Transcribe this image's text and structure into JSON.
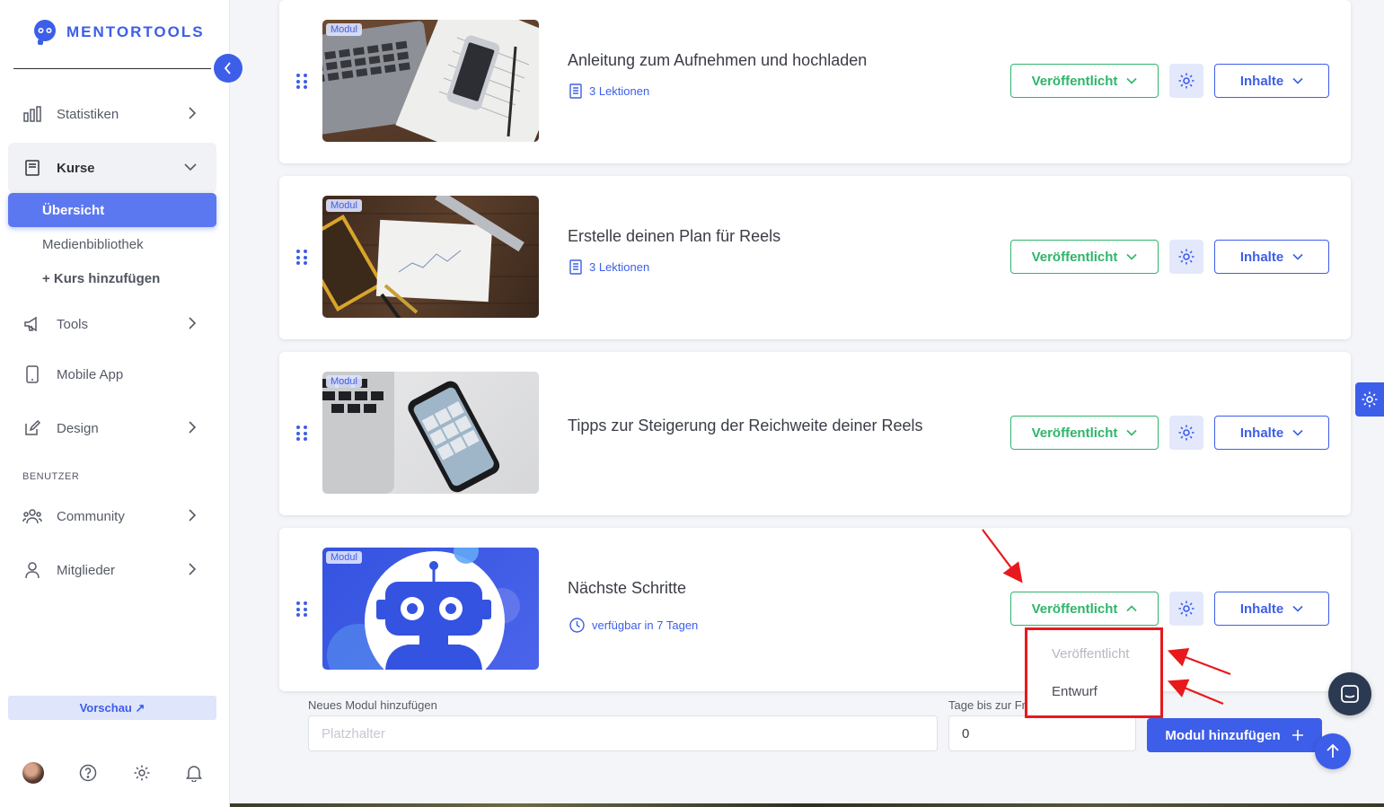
{
  "brand": {
    "name": "MENTORTOOLS"
  },
  "sidebar": {
    "items": [
      {
        "label": "Statistiken",
        "icon": "bar-chart-icon"
      },
      {
        "label": "Kurse",
        "icon": "book-icon"
      },
      {
        "label": "Tools",
        "icon": "megaphone-icon"
      },
      {
        "label": "Mobile App",
        "icon": "phone-icon"
      },
      {
        "label": "Design",
        "icon": "edit-icon"
      },
      {
        "label": "Community",
        "icon": "group-icon"
      },
      {
        "label": "Mitglieder",
        "icon": "user-icon"
      }
    ],
    "sub_items": [
      {
        "label": "Übersicht"
      },
      {
        "label": "Medienbibliothek"
      },
      {
        "label": "+ Kurs hinzufügen"
      }
    ],
    "section_users": "BENUTZER",
    "preview_label": "Vorschau ↗"
  },
  "modules": [
    {
      "badge": "Modul",
      "title": "Anleitung zum Aufnehmen und hochladen",
      "meta": "3 Lektionen",
      "meta_icon": "document-icon",
      "status": "Veröffentlicht",
      "content": "Inhalte"
    },
    {
      "badge": "Modul",
      "title": "Erstelle deinen Plan für Reels",
      "meta": "3 Lektionen",
      "meta_icon": "document-icon",
      "status": "Veröffentlicht",
      "content": "Inhalte"
    },
    {
      "badge": "Modul",
      "title": "Tipps zur Steigerung der Reichweite deiner Reels",
      "meta": "",
      "meta_icon": "",
      "status": "Veröffentlicht",
      "content": "Inhalte"
    },
    {
      "badge": "Modul",
      "title": "Nächste Schritte",
      "meta": "verfügbar in 7 Tagen",
      "meta_icon": "clock-icon",
      "status": "Veröffentlicht",
      "content": "Inhalte"
    }
  ],
  "status_dropdown": {
    "options": [
      "Veröffentlicht",
      "Entwurf"
    ]
  },
  "add_module": {
    "name_label": "Neues Modul hinzufügen",
    "name_placeholder": "Platzhalter",
    "days_label": "Tage bis zur Fr",
    "days_value": "0",
    "submit_label": "Modul hinzufügen"
  },
  "colors": {
    "accent": "#3d5ee8",
    "published_green": "#2fb56a",
    "annotation_red": "#e8191c"
  }
}
